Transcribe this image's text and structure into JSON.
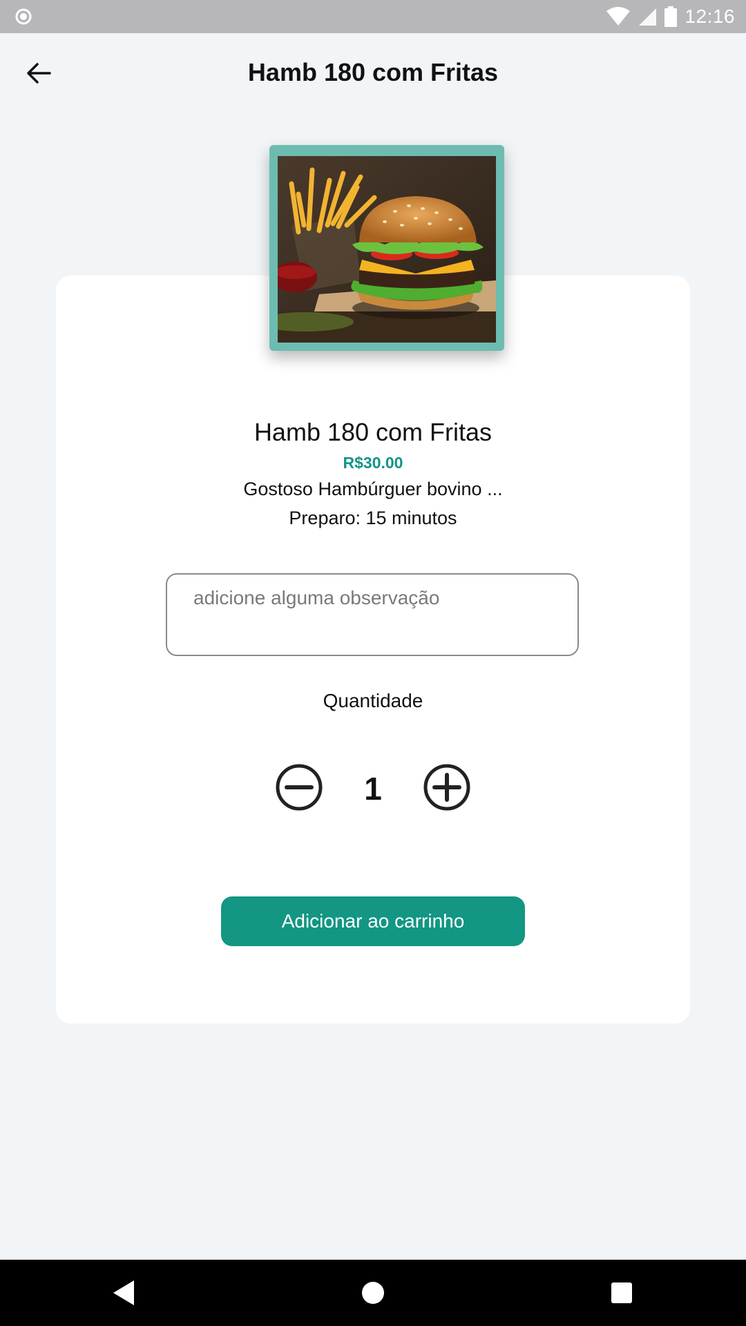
{
  "status_bar": {
    "time": "12:16",
    "icons": [
      "record-icon",
      "wifi-icon",
      "signal-icon",
      "battery-icon"
    ]
  },
  "header": {
    "title": "Hamb 180 com Fritas",
    "back_icon": "arrow-left-icon"
  },
  "product": {
    "image_alt": "burger-with-fries-photo",
    "name": "Hamb 180 com Fritas",
    "price": "R$30.00",
    "description": "Gostoso Hambúrguer bovino ...",
    "prep_time": "Preparo: 15 minutos"
  },
  "note": {
    "placeholder": "adicione alguma observação",
    "value": ""
  },
  "quantity": {
    "label": "Quantidade",
    "value": "1",
    "minus_icon": "minus-circle-icon",
    "plus_icon": "plus-circle-icon"
  },
  "actions": {
    "add_to_cart_label": "Adicionar ao carrinho"
  },
  "colors": {
    "accent": "#139683",
    "price": "#139487",
    "image_frame": "#6dbcb1",
    "background": "#f2f5f8",
    "status_bar": "#b7b7b9"
  },
  "nav_bar": {
    "icons": [
      "nav-back-icon",
      "nav-home-icon",
      "nav-recent-icon"
    ]
  }
}
